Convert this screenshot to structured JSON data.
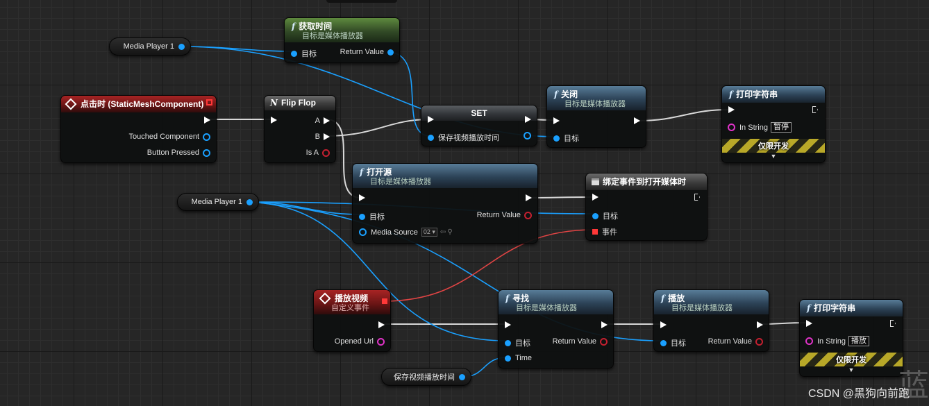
{
  "colors": {
    "exec_wire": "#d8d8d8",
    "object_wire": "#1aa0ff",
    "delegate_wire": "#e04444",
    "pure_function_header": "#5e8a3e",
    "function_header": "#587c98",
    "event_header": "#a82424",
    "dev_stripe": "#b8a828"
  },
  "variables": {
    "media_player_top": "Media Player 1",
    "media_player_mid": "Media Player 1",
    "save_time_get": "保存视频播放时间"
  },
  "get_time": {
    "icon": "function-icon",
    "title": "获取时间",
    "subtitle": "目标是媒体播放器",
    "target": "目标",
    "return": "Return Value"
  },
  "on_click": {
    "title": "点击时 (StaticMeshComponent)",
    "touched": "Touched Component",
    "button": "Button Pressed"
  },
  "flip_flop": {
    "title": "Flip Flop",
    "a": "A",
    "b": "B",
    "is_a": "Is A"
  },
  "set_node": {
    "title": "SET",
    "var": "保存视频播放时间"
  },
  "close": {
    "title": "关闭",
    "subtitle": "目标是媒体播放器",
    "target": "目标"
  },
  "print_top": {
    "title": "打印字符串",
    "in_string": "In String",
    "value": "暂停",
    "dev": "仅限开发"
  },
  "open_source": {
    "title": "打开源",
    "subtitle": "目标是媒体播放器",
    "target": "目标",
    "return": "Return Value",
    "media_source": "Media Source",
    "combo": "02"
  },
  "bind_event": {
    "title": "绑定事件到打开媒体时",
    "target": "目标",
    "event": "事件"
  },
  "play_event": {
    "title": "播放视频",
    "subtitle": "自定义事件",
    "opened_url": "Opened Url"
  },
  "seek": {
    "title": "寻找",
    "subtitle": "目标是媒体播放器",
    "target": "目标",
    "return": "Return Value",
    "time": "Time"
  },
  "play": {
    "title": "播放",
    "subtitle": "目标是媒体播放器",
    "target": "目标",
    "return": "Return Value"
  },
  "print_bottom": {
    "title": "打印字符串",
    "in_string": "In String",
    "value": "播放",
    "dev": "仅限开发"
  },
  "watermark": "CSDN @黑狗向前跑",
  "corner_glyph": "蓝"
}
